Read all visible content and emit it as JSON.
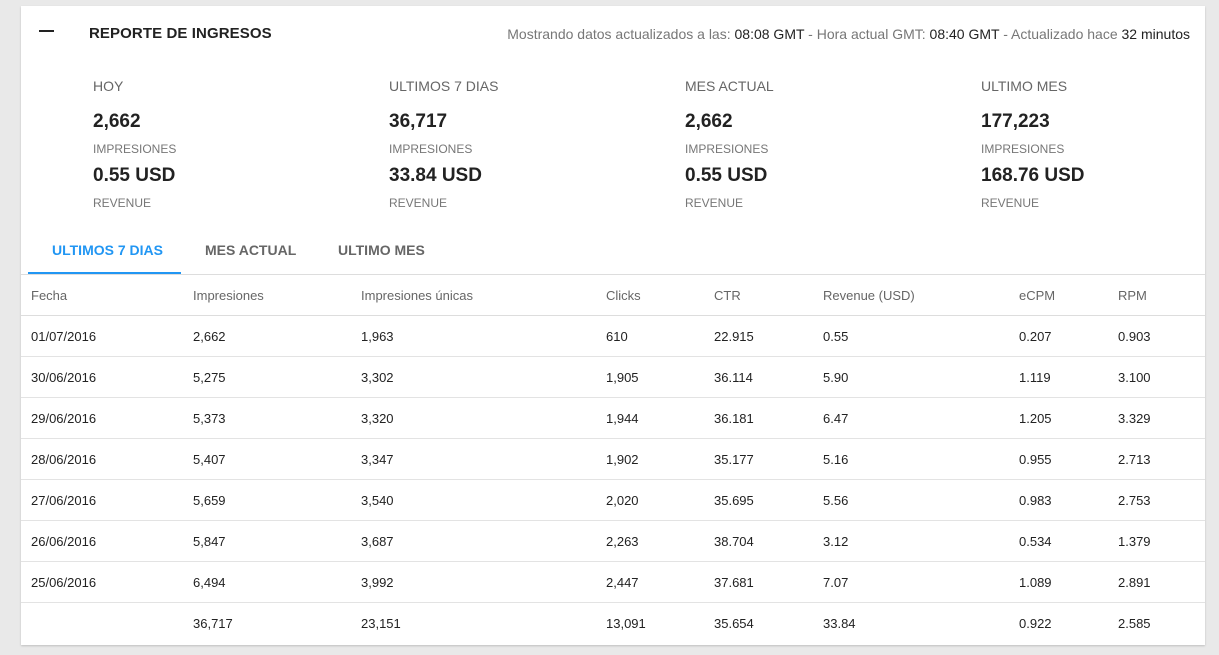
{
  "header": {
    "title": "REPORTE DE INGRESOS",
    "status_prefix": "Mostrando datos actualizados a las: ",
    "updated_time": "08:08 GMT",
    "status_mid": " - Hora actual GMT: ",
    "current_time": "08:40 GMT",
    "status_mid2": " - Actualizado hace ",
    "minutes_ago": "32 minutos"
  },
  "stats": [
    {
      "label": "HOY",
      "impressions": "2,662",
      "impressions_label": "IMPRESIONES",
      "revenue": "0.55 USD",
      "revenue_label": "REVENUE"
    },
    {
      "label": "ULTIMOS 7 DIAS",
      "impressions": "36,717",
      "impressions_label": "IMPRESIONES",
      "revenue": "33.84 USD",
      "revenue_label": "REVENUE"
    },
    {
      "label": "MES ACTUAL",
      "impressions": "2,662",
      "impressions_label": "IMPRESIONES",
      "revenue": "0.55 USD",
      "revenue_label": "REVENUE"
    },
    {
      "label": "ULTIMO MES",
      "impressions": "177,223",
      "impressions_label": "IMPRESIONES",
      "revenue": "168.76 USD",
      "revenue_label": "REVENUE"
    }
  ],
  "tabs": [
    {
      "label": "ULTIMOS 7 DIAS",
      "active": true
    },
    {
      "label": "MES ACTUAL",
      "active": false
    },
    {
      "label": "ULTIMO MES",
      "active": false
    }
  ],
  "colors": {
    "accent": "#2196f3"
  },
  "table": {
    "columns": [
      "Fecha",
      "Impresiones",
      "Impresiones únicas",
      "Clicks",
      "CTR",
      "Revenue (USD)",
      "eCPM",
      "RPM"
    ],
    "rows": [
      [
        "01/07/2016",
        "2,662",
        "1,963",
        "610",
        "22.915",
        "0.55",
        "0.207",
        "0.903"
      ],
      [
        "30/06/2016",
        "5,275",
        "3,302",
        "1,905",
        "36.114",
        "5.90",
        "1.119",
        "3.100"
      ],
      [
        "29/06/2016",
        "5,373",
        "3,320",
        "1,944",
        "36.181",
        "6.47",
        "1.205",
        "3.329"
      ],
      [
        "28/06/2016",
        "5,407",
        "3,347",
        "1,902",
        "35.177",
        "5.16",
        "0.955",
        "2.713"
      ],
      [
        "27/06/2016",
        "5,659",
        "3,540",
        "2,020",
        "35.695",
        "5.56",
        "0.983",
        "2.753"
      ],
      [
        "26/06/2016",
        "5,847",
        "3,687",
        "2,263",
        "38.704",
        "3.12",
        "0.534",
        "1.379"
      ],
      [
        "25/06/2016",
        "6,494",
        "3,992",
        "2,447",
        "37.681",
        "7.07",
        "1.089",
        "2.891"
      ]
    ],
    "totals": [
      "",
      "36,717",
      "23,151",
      "13,091",
      "35.654",
      "33.84",
      "0.922",
      "2.585"
    ]
  }
}
